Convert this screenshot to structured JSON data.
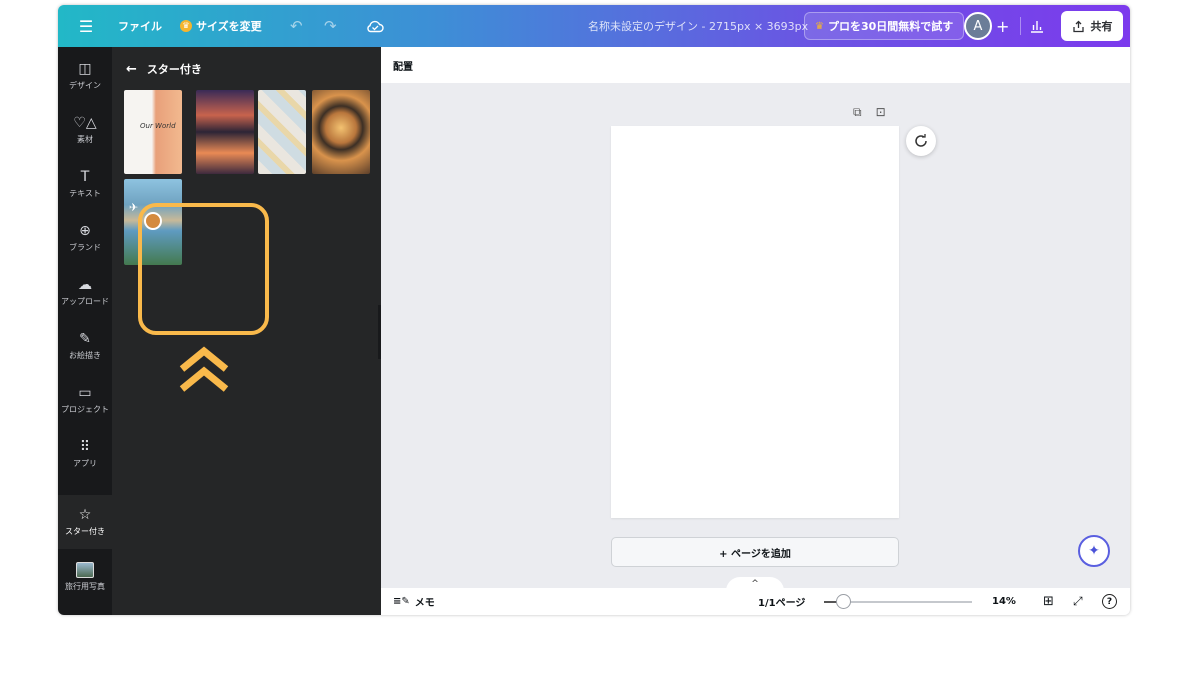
{
  "topbar": {
    "file_label": "ファイル",
    "resize_label": "サイズを変更",
    "design_title": "名称未設定のデザイン - 2715px × 3693px",
    "pro_label": "プロを30日間無料で試す",
    "avatar_letter": "A",
    "share_label": "共有"
  },
  "rail": {
    "items": [
      {
        "label": "デザイン",
        "icon": "layout-icon"
      },
      {
        "label": "素材",
        "icon": "elements-icon"
      },
      {
        "label": "テキスト",
        "icon": "text-icon"
      },
      {
        "label": "ブランド",
        "icon": "brand-icon"
      },
      {
        "label": "アップロード",
        "icon": "upload-icon"
      },
      {
        "label": "お絵描き",
        "icon": "draw-icon"
      },
      {
        "label": "プロジェクト",
        "icon": "folder-icon"
      },
      {
        "label": "アプリ",
        "icon": "apps-icon"
      },
      {
        "label": "スター付き",
        "icon": "star-icon"
      },
      {
        "label": "旅行用写真",
        "icon": "photo-thumb"
      }
    ]
  },
  "panel": {
    "title": "スター付き",
    "tile_1_text": "Our World"
  },
  "editor": {
    "arrange_label": "配置",
    "add_page_label": "+ ページを追加",
    "notes_label": "メモ",
    "page_count": "1/1ページ",
    "zoom_value": "14%"
  },
  "colors": {
    "highlight": "#f9b94b",
    "rail_bg": "#18191b",
    "panel_bg": "#252627"
  }
}
